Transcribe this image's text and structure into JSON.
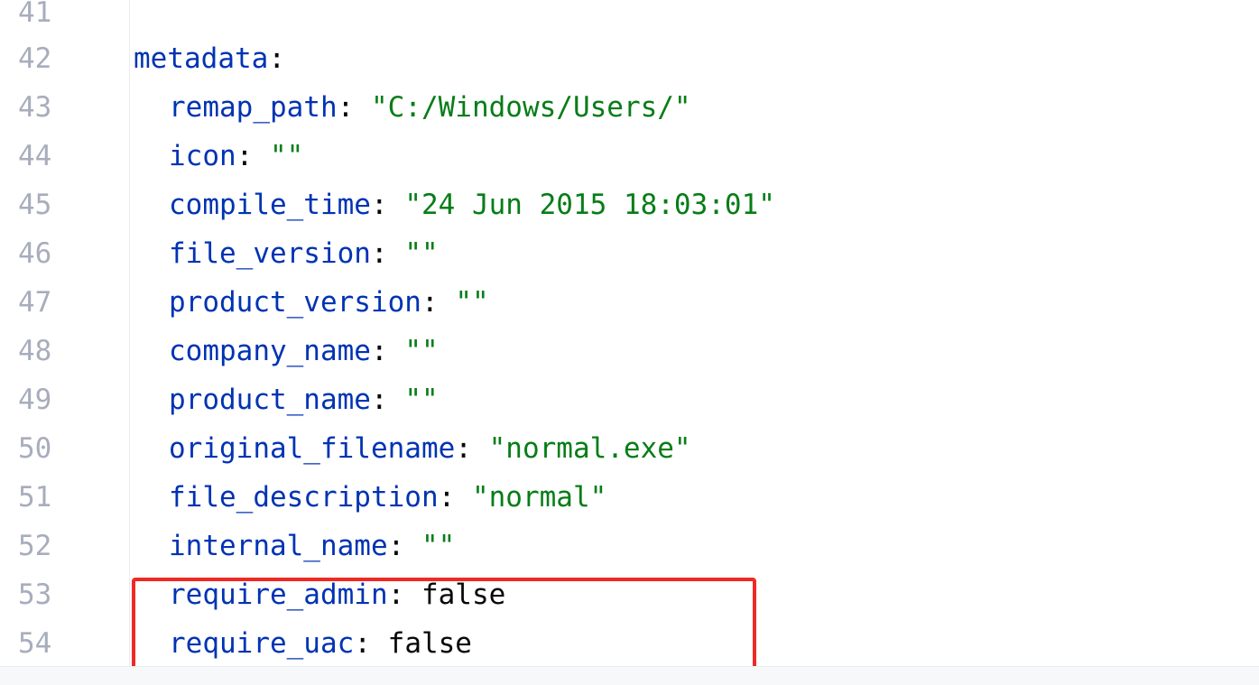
{
  "editor": {
    "lines": [
      {
        "num": "41",
        "key": "",
        "value": "",
        "value_type": "none"
      },
      {
        "num": "42",
        "key": "metadata",
        "value": "",
        "value_type": "none"
      },
      {
        "num": "43",
        "key": "remap_path",
        "value": "\"C:/Windows/Users/\"",
        "value_type": "string"
      },
      {
        "num": "44",
        "key": "icon",
        "value": "\"\"",
        "value_type": "string"
      },
      {
        "num": "45",
        "key": "compile_time",
        "value": "\"24 Jun 2015 18:03:01\"",
        "value_type": "string"
      },
      {
        "num": "46",
        "key": "file_version",
        "value": "\"\"",
        "value_type": "string"
      },
      {
        "num": "47",
        "key": "product_version",
        "value": "\"\"",
        "value_type": "string"
      },
      {
        "num": "48",
        "key": "company_name",
        "value": "\"\"",
        "value_type": "string"
      },
      {
        "num": "49",
        "key": "product_name",
        "value": "\"\"",
        "value_type": "string"
      },
      {
        "num": "50",
        "key": "original_filename",
        "value": "\"normal.exe\"",
        "value_type": "string"
      },
      {
        "num": "51",
        "key": "file_description",
        "value": "\"normal\"",
        "value_type": "string"
      },
      {
        "num": "52",
        "key": "internal_name",
        "value": "\"\"",
        "value_type": "string"
      },
      {
        "num": "53",
        "key": "require_admin",
        "value": "false",
        "value_type": "plain"
      },
      {
        "num": "54",
        "key": "require_uac",
        "value": "false",
        "value_type": "plain"
      }
    ],
    "colon": ":",
    "colors": {
      "key": "#0033b3",
      "string": "#067d17",
      "plain": "#080808",
      "line_number": "#a8adbd",
      "highlight_box": "#ee2a24"
    }
  }
}
